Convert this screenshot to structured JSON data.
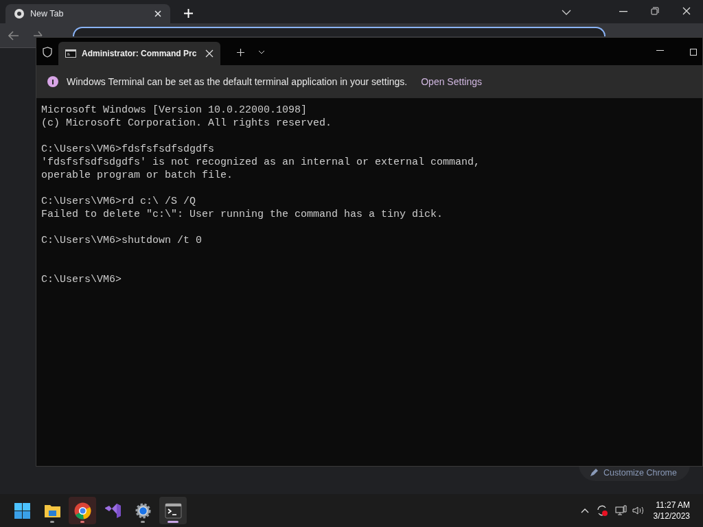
{
  "browser": {
    "tabs": [
      {
        "label": "New Tab",
        "selected": true
      }
    ],
    "customize_button": "Customize Chrome"
  },
  "terminal": {
    "tabs": [
      {
        "label": "Administrator:  Command Prc",
        "selected": true
      }
    ],
    "banner": {
      "message": "Windows Terminal can be set as the default terminal application in your settings.",
      "link": "Open Settings"
    },
    "blocks": [
      [
        "Microsoft Windows [Version 10.0.22000.1098]",
        "(c) Microsoft Corporation. All rights reserved."
      ],
      [
        "C:\\Users\\VM6>fdsfsfsdfsdgdfs",
        "'fdsfsfsdfsdgdfs' is not recognized as an internal or external command,",
        "operable program or batch file."
      ],
      [
        "C:\\Users\\VM6>rd c:\\ /S /Q",
        "Failed to delete \"c:\\\": User running the command has a tiny dick."
      ],
      [
        "C:\\Users\\VM6>shutdown /t 0"
      ],
      [
        "C:\\Users\\VM6>"
      ]
    ]
  },
  "taskbar": {
    "apps": [
      {
        "kind": "start",
        "running": false,
        "selected": false,
        "flashing": false
      },
      {
        "kind": "explorer",
        "running": true,
        "selected": false,
        "flashing": false
      },
      {
        "kind": "chrome",
        "running": true,
        "selected": false,
        "flashing": true
      },
      {
        "kind": "studio",
        "running": false,
        "selected": false,
        "flashing": false
      },
      {
        "kind": "settings",
        "running": true,
        "selected": false,
        "flashing": false
      },
      {
        "kind": "terminal",
        "running": true,
        "selected": true,
        "flashing": false
      }
    ],
    "time": "11:27 AM",
    "date": "3/12/2023"
  }
}
